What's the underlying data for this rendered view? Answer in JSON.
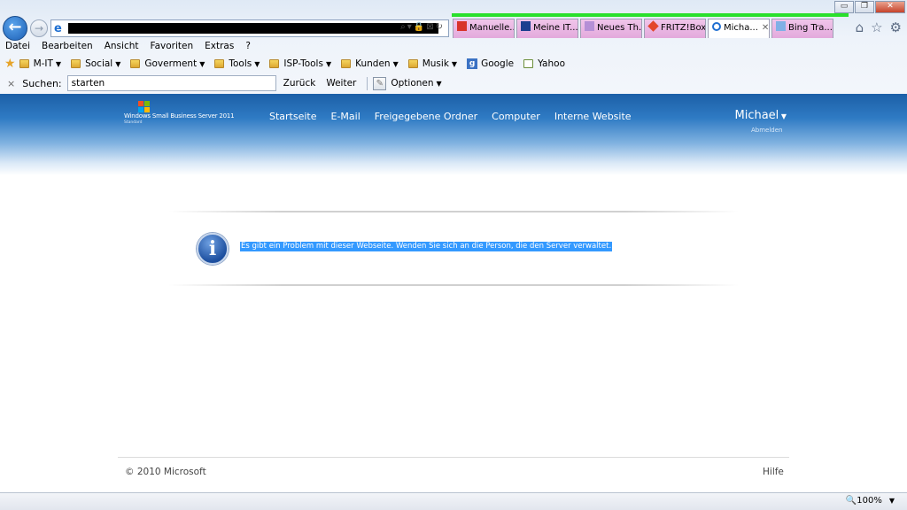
{
  "window": {
    "minimize": "▭",
    "restore": "❐",
    "close": "✕"
  },
  "nav": {
    "back": "←",
    "forward": "→"
  },
  "tabs": [
    {
      "label": "Manuelle...",
      "icon": "red-bars-icon",
      "color": "#d8332a"
    },
    {
      "label": "Meine IT...",
      "icon": "mm-logo-icon",
      "color": "#1b3f8f"
    },
    {
      "label": "Neues Th...",
      "icon": "feather-icon",
      "color": "#7a4fa0"
    },
    {
      "label": "FRITZ!Box",
      "icon": "fritz-icon",
      "color": "#e3452b"
    },
    {
      "label": "Micha...",
      "icon": "ie-icon",
      "color": "#1f6fd1",
      "active": true,
      "close": "✕"
    },
    {
      "label": "Bing Tra...",
      "icon": "translate-icon",
      "color": "#4a8ad0"
    }
  ],
  "toolbar_icons": {
    "home": "⌂",
    "favorites": "☆",
    "settings": "⚙"
  },
  "menu": [
    "Datei",
    "Bearbeiten",
    "Ansicht",
    "Favoriten",
    "Extras",
    "?"
  ],
  "favorites": [
    {
      "label": "M-IT",
      "dropdown": true
    },
    {
      "label": "Social",
      "dropdown": true
    },
    {
      "label": "Goverment",
      "dropdown": true
    },
    {
      "label": "Tools",
      "dropdown": true
    },
    {
      "label": "ISP-Tools",
      "dropdown": true
    },
    {
      "label": "Kunden",
      "dropdown": true
    },
    {
      "label": "Musik",
      "dropdown": true
    }
  ],
  "favlinks": {
    "google": "Google",
    "yahoo": "Yahoo"
  },
  "search": {
    "close": "×",
    "label": "Suchen:",
    "value": "starten",
    "back": "Zurück",
    "forward": "Weiter",
    "options": "Optionen"
  },
  "sbs": {
    "logo_text": "Windows Small Business Server 2011",
    "logo_sub": "Standard",
    "nav": [
      "Startseite",
      "E-Mail",
      "Freigegebene Ordner",
      "Computer",
      "Interne Website"
    ],
    "user": "Michael",
    "logout": "Abmelden"
  },
  "message": {
    "icon": "i",
    "text": "Es gibt ein Problem mit dieser Webseite. Wenden Sie sich an die Person, die den Server verwaltet."
  },
  "footer": {
    "copyright": "© 2010 Microsoft",
    "help": "Hilfe"
  },
  "status": {
    "zoom": "100%"
  }
}
